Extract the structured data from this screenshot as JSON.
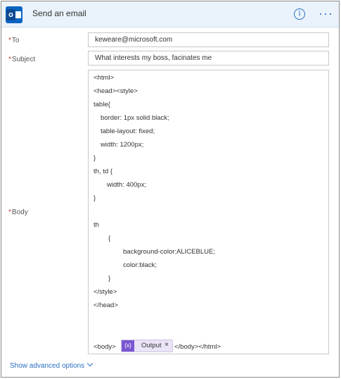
{
  "header": {
    "app_badge": "o",
    "title": "Send an email",
    "info_glyph": "i",
    "more_glyph": "···"
  },
  "fields": {
    "to": {
      "label": "To",
      "required_mark": "*",
      "value": "keweare@microsoft.com"
    },
    "subject": {
      "label": "Subject",
      "required_mark": "*",
      "value": "What interests my boss, facinates me"
    },
    "body": {
      "label": "Body",
      "required_mark": "*",
      "lines": [
        "<html>",
        "<head><style>",
        "table{",
        "border: 1px solid black;",
        "table-layout: fixed;",
        "width: 1200px;",
        "}",
        "th, td {",
        "width: 400px;",
        "}",
        "th",
        "{",
        "background-color:ALICEBLUE;",
        "color:black;",
        "}",
        "</style>",
        "</head>",
        "<body>",
        "</body></html>"
      ],
      "token": {
        "icon": "{x}",
        "label": "Output",
        "close": "×"
      }
    }
  },
  "footer": {
    "advanced_label": "Show advanced options"
  },
  "colors": {
    "accent": "#2b6fc1",
    "header_bg": "#eaf3fb",
    "required": "#c43a3a",
    "token_bg": "#ebe4f7",
    "token_icon": "#7a57d1"
  },
  "icons": [
    "outlook-app-icon",
    "info-icon",
    "more-options-icon",
    "expression-icon",
    "close-icon",
    "chevron-down-icon"
  ]
}
